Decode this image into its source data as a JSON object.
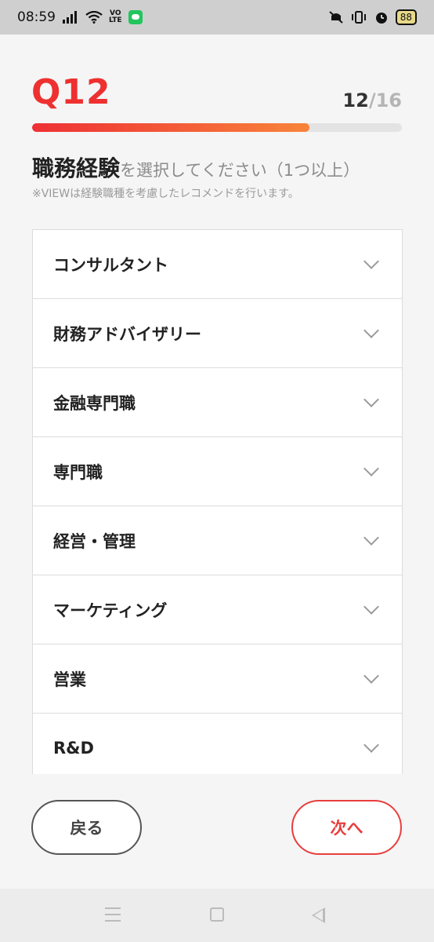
{
  "status_bar": {
    "time": "08:59",
    "network_label_top": "VO",
    "network_label_bottom": "LTE",
    "battery": "88"
  },
  "question": {
    "number": "Q12",
    "progress_current": "12",
    "progress_separator": "/",
    "progress_total": "16",
    "progress_fraction": 0.75,
    "instruction_strong": "職務経験",
    "instruction_rest": "を選択してください（1つ以上）",
    "note": "※VIEWは経験職種を考慮したレコメンドを行います。"
  },
  "categories": [
    {
      "label": "コンサルタント"
    },
    {
      "label": "財務アドバイザリー"
    },
    {
      "label": "金融専門職"
    },
    {
      "label": "専門職"
    },
    {
      "label": "経営・管理"
    },
    {
      "label": "マーケティング"
    },
    {
      "label": "営業"
    },
    {
      "label": "R&D"
    }
  ],
  "buttons": {
    "back_label": "戻る",
    "next_label": "次へ"
  },
  "colors": {
    "accent": "#ee3030",
    "progress_start": "#ee3035",
    "progress_end": "#f8843a"
  },
  "icons": {
    "chevron": "chevron-down-icon",
    "nav_menu": "menu-icon",
    "nav_home": "home-icon",
    "nav_back": "back-triangle-icon"
  }
}
